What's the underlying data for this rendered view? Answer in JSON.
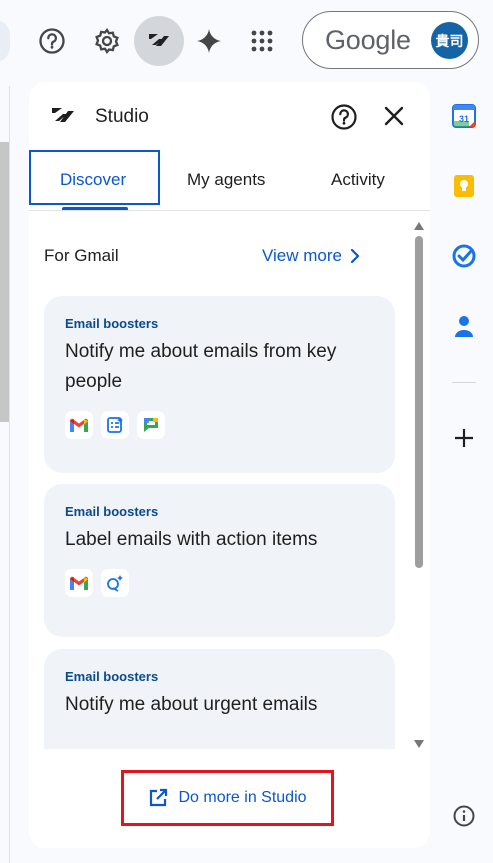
{
  "topbar": {
    "icons": [
      "help-icon",
      "settings-icon",
      "studio-icon",
      "gemini-icon",
      "apps-grid-icon"
    ],
    "google_label": "Google",
    "avatar_text": "貴司"
  },
  "panel": {
    "title": "Studio",
    "tabs": [
      {
        "label": "Discover",
        "active": true
      },
      {
        "label": "My agents",
        "active": false
      },
      {
        "label": "Activity",
        "active": false
      }
    ],
    "section_label": "For Gmail",
    "view_more": "View more",
    "cards": [
      {
        "category": "Email boosters",
        "title": "Notify me about emails from key people",
        "apps": [
          "gmail",
          "sheets",
          "chat"
        ]
      },
      {
        "category": "Email boosters",
        "title": "Label emails with action items",
        "apps": [
          "gmail",
          "gemini"
        ]
      },
      {
        "category": "Email boosters",
        "title": "Notify me about urgent emails",
        "apps": []
      }
    ],
    "footer_button": "Do more in Studio"
  },
  "right_rail": {
    "icons": [
      "calendar-icon",
      "keep-icon",
      "tasks-icon",
      "contacts-icon",
      "add-icon",
      "info-icon"
    ],
    "calendar_day": "31"
  },
  "colors": {
    "accent": "#0b57d0",
    "highlight_box": "#e3141b"
  }
}
